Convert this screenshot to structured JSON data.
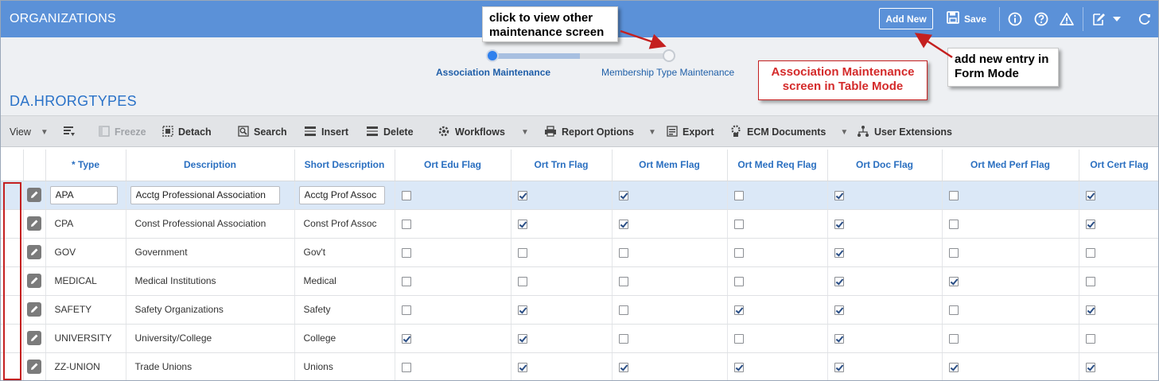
{
  "app": {
    "title": "ORGANIZATIONS"
  },
  "topbar": {
    "add_new_label": "Add New",
    "save_label": "Save"
  },
  "stepper": {
    "steps": [
      {
        "label": "Association Maintenance",
        "active": true
      },
      {
        "label": "Membership Type Maintenance",
        "active": false
      }
    ]
  },
  "table_name": "DA.HRORGTYPES",
  "callouts": {
    "click_line1": "click to view other",
    "click_line2": "maintenance screen",
    "add_line1": "add new entry in",
    "add_line2": "Form Mode",
    "assoc_line1": "Association Maintenance",
    "assoc_line2": "screen in Table Mode"
  },
  "toolbar": {
    "view": "View",
    "freeze": "Freeze",
    "detach": "Detach",
    "search": "Search",
    "insert": "Insert",
    "delete": "Delete",
    "workflows": "Workflows",
    "report_options": "Report Options",
    "export": "Export",
    "ecm_documents": "ECM Documents",
    "user_extensions": "User Extensions"
  },
  "grid": {
    "columns": [
      "* Type",
      "Description",
      "Short Description",
      "Ort Edu Flag",
      "Ort Trn Flag",
      "Ort Mem Flag",
      "Ort Med Req Flag",
      "Ort Doc Flag",
      "Ort Med Perf Flag",
      "Ort Cert Flag"
    ],
    "rows": [
      {
        "type": "APA",
        "description": "Acctg Professional Association",
        "short": "Acctg Prof Assoc",
        "flags": [
          false,
          true,
          true,
          false,
          true,
          false,
          true
        ]
      },
      {
        "type": "CPA",
        "description": "Const Professional Association",
        "short": "Const Prof Assoc",
        "flags": [
          false,
          true,
          true,
          false,
          true,
          false,
          true
        ]
      },
      {
        "type": "GOV",
        "description": "Government",
        "short": "Gov't",
        "flags": [
          false,
          false,
          false,
          false,
          true,
          false,
          false
        ]
      },
      {
        "type": "MEDICAL",
        "description": "Medical Institutions",
        "short": "Medical",
        "flags": [
          false,
          false,
          false,
          false,
          true,
          true,
          false
        ]
      },
      {
        "type": "SAFETY",
        "description": "Safety Organizations",
        "short": "Safety",
        "flags": [
          false,
          true,
          false,
          true,
          true,
          false,
          true
        ]
      },
      {
        "type": "UNIVERSITY",
        "description": "University/College",
        "short": "College",
        "flags": [
          true,
          true,
          false,
          false,
          true,
          false,
          false
        ]
      },
      {
        "type": "ZZ-UNION",
        "description": "Trade Unions",
        "short": "Unions",
        "flags": [
          false,
          true,
          true,
          true,
          true,
          true,
          true
        ]
      }
    ]
  },
  "colors": {
    "header_blue": "#5b91d8",
    "annotation_red": "#c42020",
    "selected_row": "#dbe8f7"
  }
}
